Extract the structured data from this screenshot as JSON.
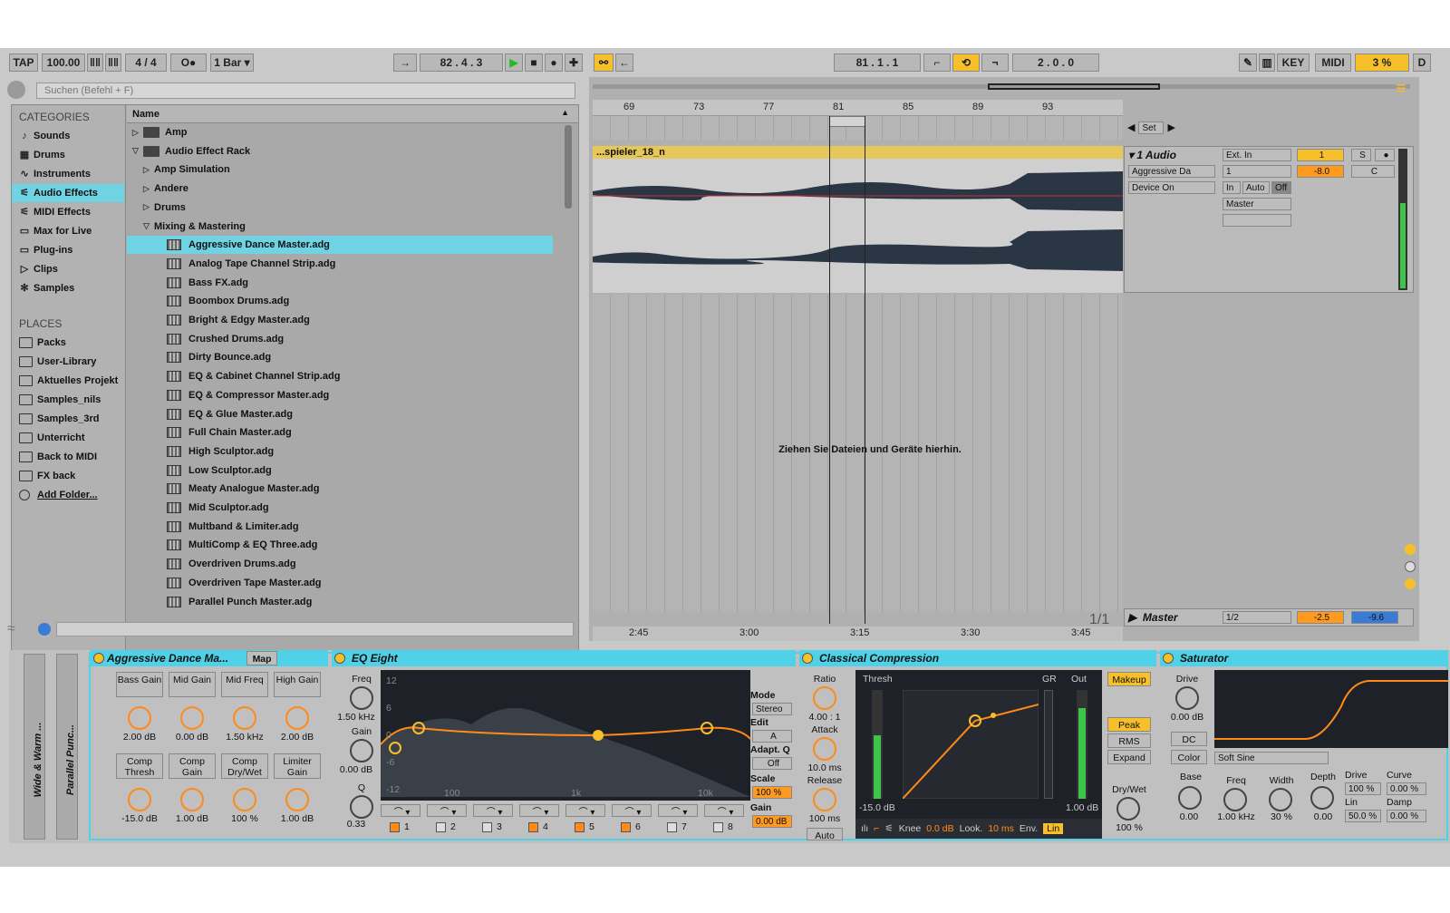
{
  "toolbar": {
    "tap": "TAP",
    "bpm": "100.00",
    "sig": "4 / 4",
    "metro": "O●",
    "quant": "1 Bar",
    "pos": "82 .  4 .  3",
    "loop_start": "81 .  1 .  1",
    "loop_len": "2 .  0 .  0",
    "key": "KEY",
    "midi": "MIDI",
    "cpu": "3 %",
    "d": "D"
  },
  "browser": {
    "search_placeholder": "Suchen (Befehl + F)",
    "categories_title": "CATEGORIES",
    "name_header": "Name",
    "places_title": "PLACES",
    "categories": [
      {
        "label": "Sounds",
        "icon": "♪"
      },
      {
        "label": "Drums",
        "icon": "▦"
      },
      {
        "label": "Instruments",
        "icon": "∿"
      },
      {
        "label": "Audio Effects",
        "icon": "⚟"
      },
      {
        "label": "MIDI Effects",
        "icon": "⚟"
      },
      {
        "label": "Max for Live",
        "icon": "▭"
      },
      {
        "label": "Plug-ins",
        "icon": "▭"
      },
      {
        "label": "Clips",
        "icon": "▷"
      },
      {
        "label": "Samples",
        "icon": "✻"
      }
    ],
    "places": [
      "Packs",
      "User-Library",
      "Aktuelles Projekt",
      "Samples_nils",
      "Samples_3rd",
      "Unterricht",
      "Back to MIDI",
      "FX back",
      "Add Folder..."
    ],
    "folders": [
      "Amp",
      "Audio Effect Rack"
    ],
    "subfolders": [
      "Amp Simulation",
      "Andere",
      "Drums",
      "Mixing & Mastering"
    ],
    "files": [
      "Aggressive Dance Master.adg",
      "Analog Tape Channel Strip.adg",
      "Bass FX.adg",
      "Boombox Drums.adg",
      "Bright & Edgy Master.adg",
      "Crushed Drums.adg",
      "Dirty Bounce.adg",
      "EQ & Cabinet Channel Strip.adg",
      "EQ & Compressor Master.adg",
      "EQ & Glue Master.adg",
      "Full Chain Master.adg",
      "High Sculptor.adg",
      "Low Sculptor.adg",
      "Meaty Analogue Master.adg",
      "Mid Sculptor.adg",
      "Multband & Limiter.adg",
      "MultiComp & EQ Three.adg",
      "Overdriven Drums.adg",
      "Overdriven Tape Master.adg",
      "Parallel Punch Master.adg"
    ]
  },
  "arrangement": {
    "bars": [
      "69",
      "73",
      "77",
      "81",
      "85",
      "89",
      "93"
    ],
    "clip_name": "...spieler_18_n",
    "drop_hint": "Ziehen Sie Dateien und Geräte hierhin.",
    "times": [
      "2:45",
      "3:00",
      "3:15",
      "3:30",
      "3:45"
    ],
    "page": "1/1",
    "set": "Set"
  },
  "track": {
    "name": "1 Audio",
    "device": "Aggressive Da",
    "device_on": "Device On",
    "input": "Ext. In",
    "input_ch": "1",
    "in": "In",
    "auto": "Auto",
    "off": "Off",
    "output": "Master",
    "num": "1",
    "vol": "-8.0",
    "solo": "S",
    "pan": "C",
    "master_name": "Master",
    "master_ch": "1/2",
    "master_vol": "-2.5",
    "master_pan": "-9.6"
  },
  "rack": {
    "title": "Aggressive Dance Ma...",
    "map": "Map",
    "macros": [
      {
        "label": "Bass Gain",
        "value": "2.00 dB"
      },
      {
        "label": "Mid  Gain",
        "value": "0.00 dB"
      },
      {
        "label": "Mid  Freq",
        "value": "1.50 kHz"
      },
      {
        "label": "High Gain",
        "value": "2.00 dB"
      },
      {
        "label": "Comp Thresh",
        "value": "-15.0 dB"
      },
      {
        "label": "Comp Gain",
        "value": "1.00 dB"
      },
      {
        "label": "Comp Dry/Wet",
        "value": "100 %"
      },
      {
        "label": "Limiter Gain",
        "value": "1.00 dB"
      }
    ],
    "side1": "Wide & Warm ...",
    "side2": "Parallel Punc..."
  },
  "eq": {
    "title": "EQ Eight",
    "freq_label": "Freq",
    "freq": "1.50 kHz",
    "gain_label": "Gain",
    "gain": "0.00 dB",
    "q_label": "Q",
    "q": "0.33",
    "db_ticks": [
      "12",
      "6",
      "0",
      "-6",
      "-12"
    ],
    "hz_ticks": [
      "100",
      "1k",
      "10k"
    ],
    "mode_label": "Mode",
    "mode": "Stereo",
    "edit_label": "Edit",
    "edit": "A",
    "adapt_label": "Adapt. Q",
    "adapt": "Off",
    "scale_label": "Scale",
    "scale": "100 %",
    "out_gain_label": "Gain",
    "out_gain": "0.00 dB",
    "bands": [
      "1",
      "2",
      "3",
      "4",
      "5",
      "6",
      "7",
      "8"
    ]
  },
  "comp": {
    "title": "Classical Compression",
    "ratio_label": "Ratio",
    "ratio": "4.00 : 1",
    "attack_label": "Attack",
    "attack": "10.0 ms",
    "release_label": "Release",
    "release": "100 ms",
    "auto": "Auto",
    "thresh_label": "Thresh",
    "thresh": "-15.0 dB",
    "gr_label": "GR",
    "out_label": "Out",
    "out": "1.00 dB",
    "knee_label": "Knee",
    "knee": "0.0 dB",
    "look_label": "Look.",
    "look": "10 ms",
    "env_label": "Env.",
    "env": "Lin",
    "makeup": "Makeup",
    "peak": "Peak",
    "rms": "RMS",
    "expand": "Expand",
    "drywet_label": "Dry/Wet",
    "drywet": "100 %"
  },
  "sat": {
    "title": "Saturator",
    "drive_label": "Drive",
    "drive": "0.00 dB",
    "dc": "DC",
    "color": "Color",
    "type": "Soft Sine",
    "base_label": "Base",
    "base": "0.00",
    "freq_label": "Freq",
    "freq": "1.00 kHz",
    "width_label": "Width",
    "width": "30 %",
    "depth_label": "Depth",
    "depth": "0.00",
    "drive2_label": "Drive",
    "drive2": "100 %",
    "curve_label": "Curve",
    "curve": "0.00 %",
    "lin_label": "Lin",
    "lin": "50.0 %",
    "damp_label": "Damp",
    "damp": "0.00 %"
  },
  "colors": {
    "accent": "#4fd2e8",
    "yellow": "#f6c02b",
    "orange": "#ff8a1a",
    "selected": "#6fd3e3"
  }
}
